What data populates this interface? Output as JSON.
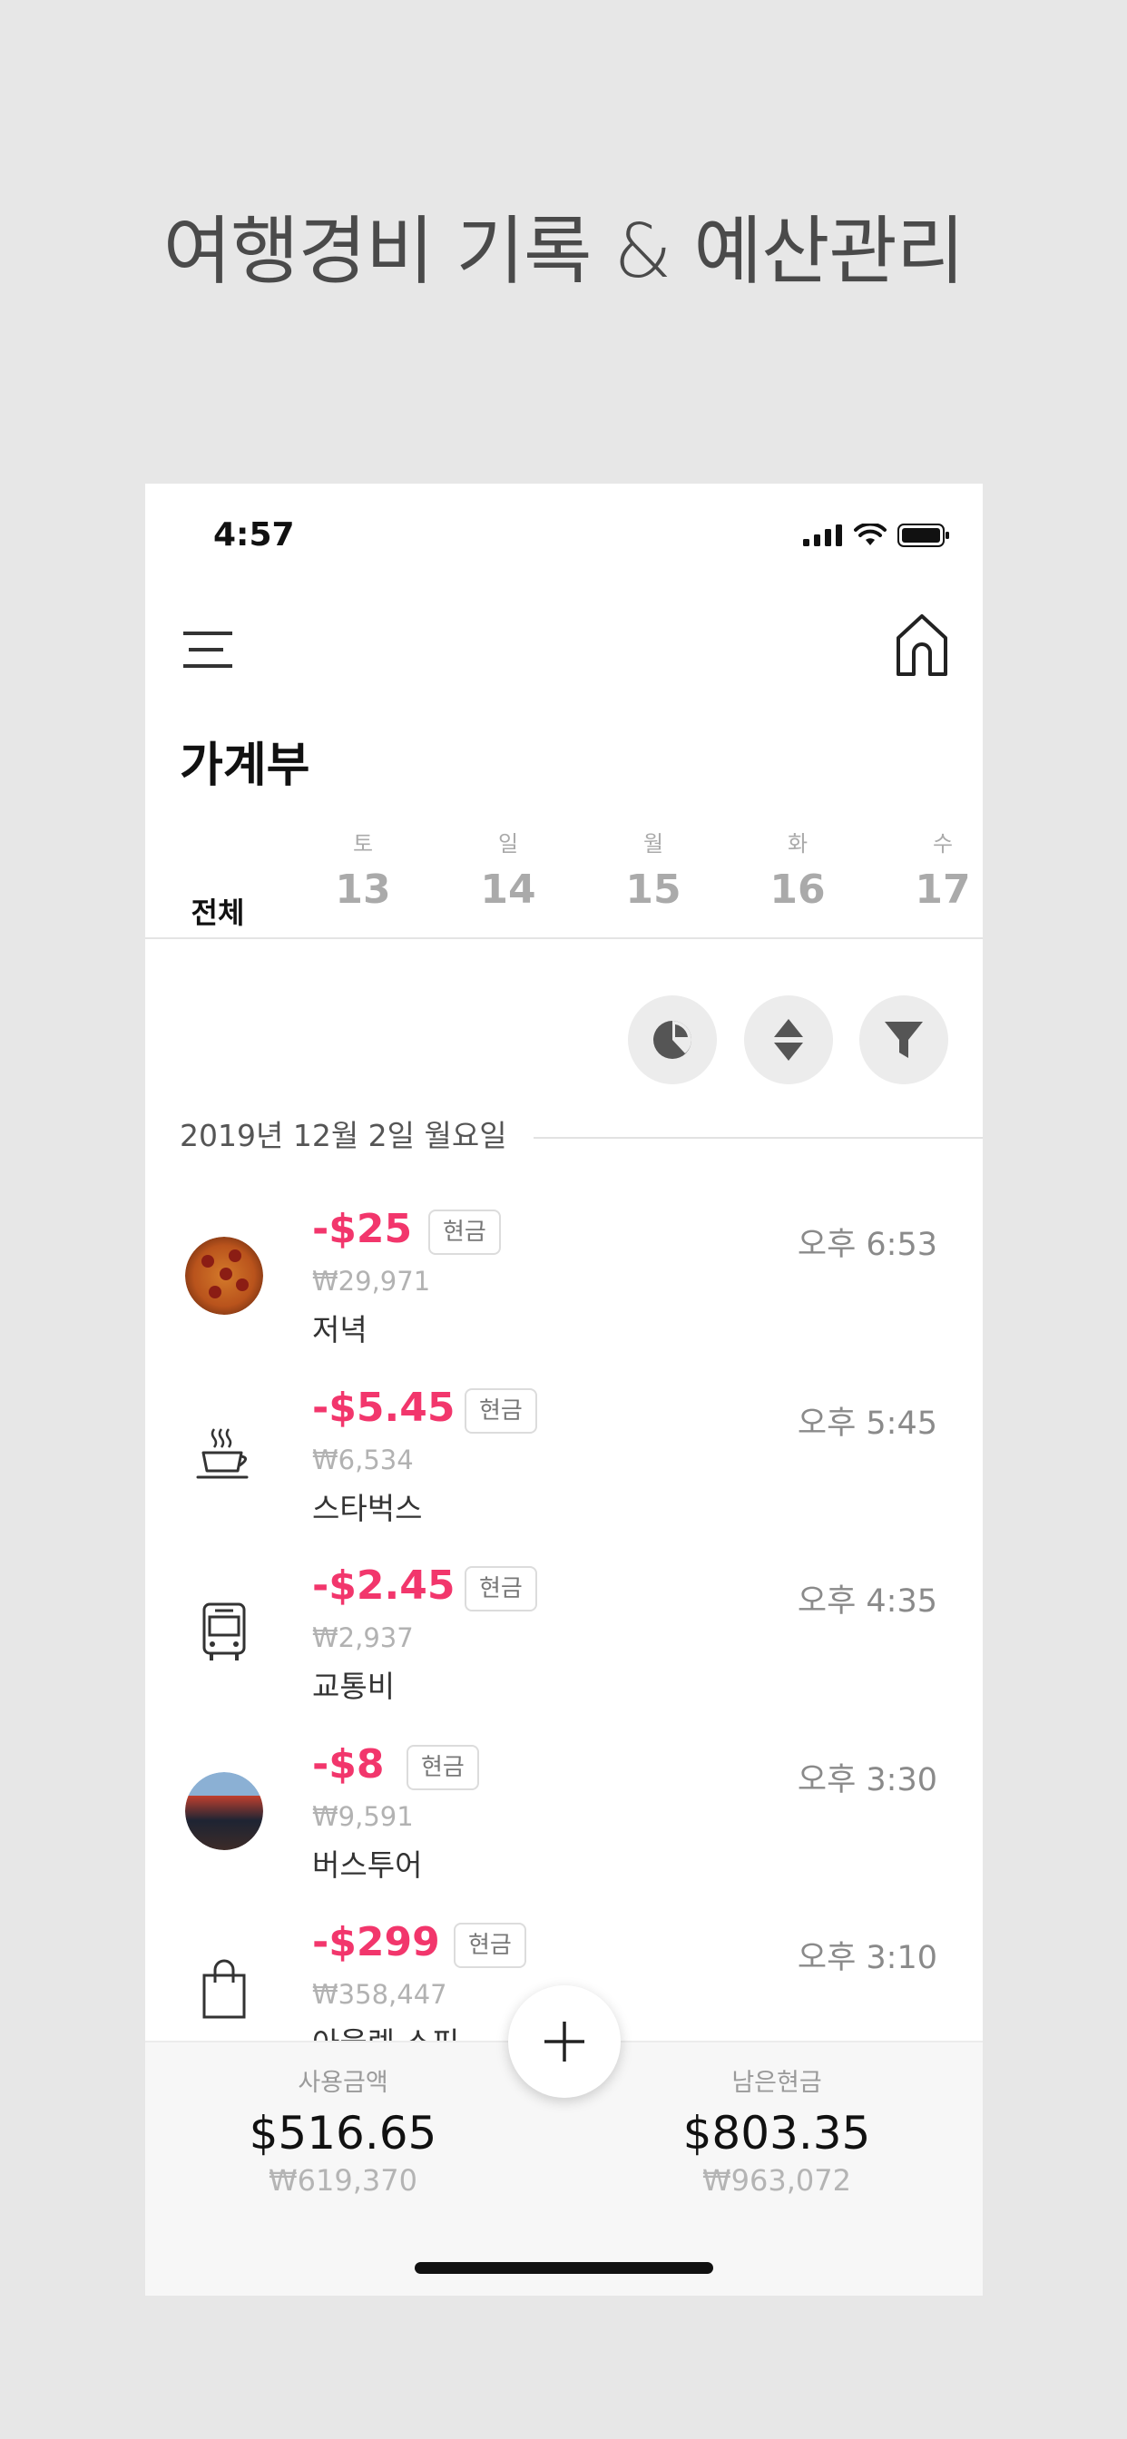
{
  "headline": "여행경비 기록 & 예산관리",
  "status": {
    "time": "4:57"
  },
  "page_title": "가계부",
  "tabs": {
    "all_label": "전체",
    "days": [
      {
        "dow": "토",
        "day": "13"
      },
      {
        "dow": "일",
        "day": "14"
      },
      {
        "dow": "월",
        "day": "15"
      },
      {
        "dow": "화",
        "day": "16"
      },
      {
        "dow": "수",
        "day": "17"
      }
    ]
  },
  "actions": [
    "pie-chart-icon",
    "sort-icon",
    "filter-icon"
  ],
  "date_header": "2019년 12월 2일 월요일",
  "transactions": [
    {
      "icon": "pizza-photo",
      "amount": "-$25",
      "method": "현금",
      "krw": "₩29,971",
      "category": "저녁",
      "time": "오후 6:53"
    },
    {
      "icon": "coffee-cup-icon",
      "amount": "-$5.45",
      "method": "현금",
      "krw": "₩6,534",
      "category": "스타벅스",
      "time": "오후 5:45"
    },
    {
      "icon": "bus-icon",
      "amount": "-$2.45",
      "method": "현금",
      "krw": "₩2,937",
      "category": "교통비",
      "time": "오후 4:35"
    },
    {
      "icon": "bus-tour-photo",
      "amount": "-$8",
      "method": "현금",
      "krw": "₩9,591",
      "category": "버스투어",
      "time": "오후 3:30"
    },
    {
      "icon": "shopping-bag-icon",
      "amount": "-$299",
      "method": "현금",
      "krw": "₩358,447",
      "category": "아울렛 쇼핑",
      "time": "오후 3:10"
    }
  ],
  "footer": {
    "spent_label": "사용금액",
    "spent_usd": "$516.65",
    "spent_krw": "₩619,370",
    "cash_label": "남은현금",
    "cash_usd": "$803.35",
    "cash_krw": "₩963,072"
  },
  "colors": {
    "accent": "#f2366c",
    "background": "#e7e7e7"
  }
}
